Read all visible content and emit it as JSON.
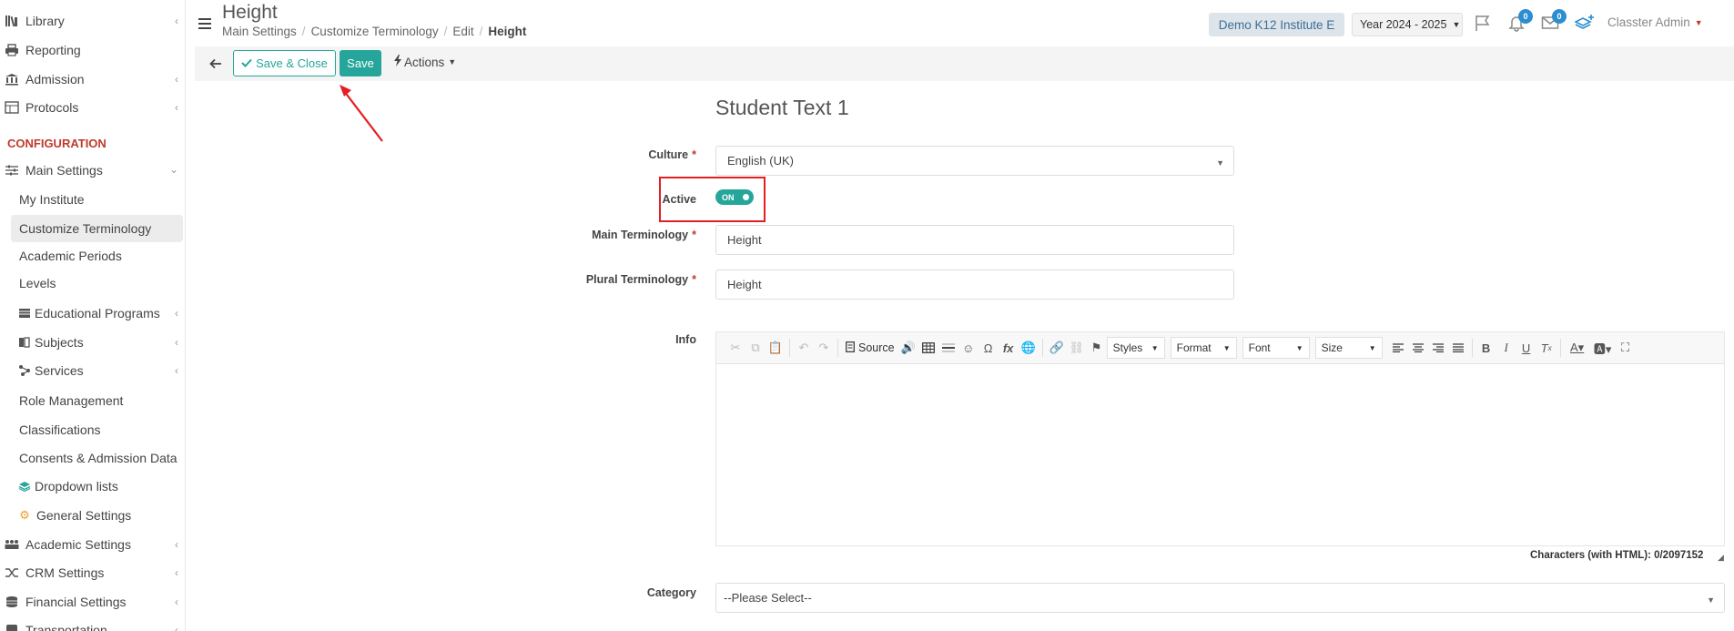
{
  "sidebar": {
    "items": [
      {
        "label": "Library",
        "icon": "library-icon",
        "chev": true
      },
      {
        "label": "Reporting",
        "icon": "printer-icon",
        "chev": false
      },
      {
        "label": "Admission",
        "icon": "bank-icon",
        "chev": true
      },
      {
        "label": "Protocols",
        "icon": "protocols-icon",
        "chev": true
      }
    ],
    "section_title": "CONFIGURATION",
    "main_settings": {
      "label": "Main Settings",
      "icon": "sliders-icon"
    },
    "sub_items": [
      {
        "label": "My Institute"
      },
      {
        "label": "Customize Terminology",
        "active": true
      },
      {
        "label": "Academic Periods"
      },
      {
        "label": "Levels"
      },
      {
        "label": "Educational Programs",
        "icon": "programs-icon",
        "chev": true
      },
      {
        "label": "Subjects",
        "icon": "book-icon",
        "chev": true
      },
      {
        "label": "Services",
        "icon": "services-icon",
        "chev": true
      },
      {
        "label": "Role Management"
      },
      {
        "label": "Classifications"
      },
      {
        "label": "Consents & Admission Data"
      },
      {
        "label": "Dropdown lists",
        "icon": "layers-icon"
      },
      {
        "label": "General Settings",
        "icon": "cog-icon"
      }
    ],
    "bottom_items": [
      {
        "label": "Academic Settings",
        "icon": "users-icon",
        "chev": true
      },
      {
        "label": "CRM Settings",
        "icon": "shuffle-icon",
        "chev": true
      },
      {
        "label": "Financial Settings",
        "icon": "database-icon",
        "chev": true
      },
      {
        "label": "Transportation",
        "icon": "bus-icon",
        "chev": true
      }
    ]
  },
  "header": {
    "title": "Height",
    "breadcrumb": [
      "Main Settings",
      "Customize Terminology",
      "Edit",
      "Height"
    ],
    "institute": "Demo K12 Institute E",
    "year": "Year 2024 - 2025",
    "notifications_count": "0",
    "messages_count": "0",
    "user": "Classter Admin"
  },
  "toolbar": {
    "save_close_label": "Save & Close",
    "save_label": "Save",
    "actions_label": "Actions"
  },
  "form": {
    "heading": "Student Text 1",
    "culture_label": "Culture",
    "culture_value": "English (UK)",
    "active_label": "Active",
    "active_toggle": "ON",
    "main_term_label": "Main Terminology",
    "main_term_value": "Height",
    "plural_term_label": "Plural Terminology",
    "plural_term_value": "Height",
    "info_label": "Info",
    "category_label": "Category",
    "category_value": "--Please Select--"
  },
  "editor": {
    "source_label": "Source",
    "styles_label": "Styles",
    "format_label": "Format",
    "font_label": "Font",
    "size_label": "Size",
    "char_count": "Characters (with HTML): 0/2097152"
  },
  "colors": {
    "accent": "#26a69a",
    "annotation": "#e31e24",
    "section": "#c0392b",
    "badge": "#2b8ed1"
  }
}
